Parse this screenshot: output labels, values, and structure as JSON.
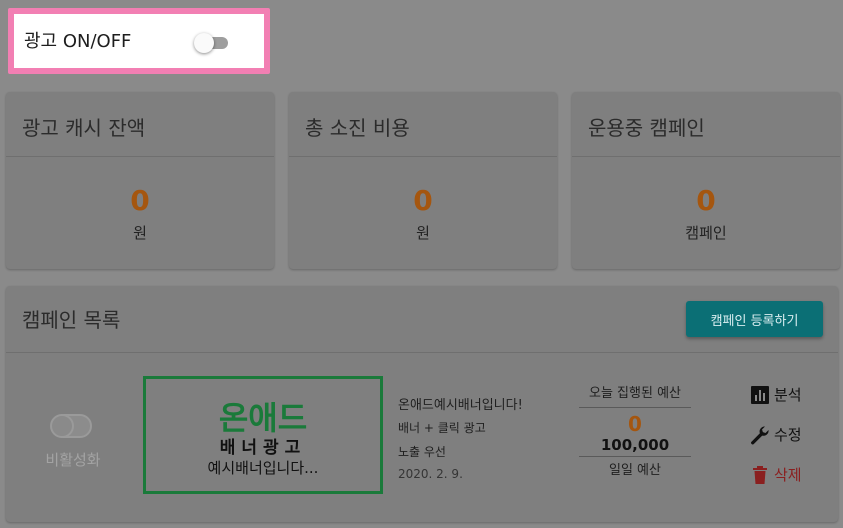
{
  "ad_toggle": {
    "label": "광고 ON/OFF"
  },
  "stats": [
    {
      "title": "광고 캐시 잔액",
      "value": "0",
      "unit": "원"
    },
    {
      "title": "총 소진 비용",
      "value": "0",
      "unit": "원"
    },
    {
      "title": "운용중 캠페인",
      "value": "0",
      "unit": "캠페인"
    }
  ],
  "campaign_list": {
    "title": "캠페인 목록",
    "register_button": "캠페인 등록하기",
    "rows": [
      {
        "status": "비활성화",
        "banner": {
          "line1": "온애드",
          "line2": "배너광고",
          "line3": "예시배너입니다..."
        },
        "name": "온애드예시배너입니다!",
        "type": "배너 + 클릭 광고",
        "exposure": "노출 우선",
        "date": "2020. 2. 9.",
        "budget": {
          "today_label": "오늘 집행된 예산",
          "today_value": "0",
          "daily_value": "100,000",
          "daily_label": "일일 예산"
        },
        "actions": {
          "analyze": "분석",
          "edit": "수정",
          "delete": "삭제"
        }
      }
    ]
  },
  "colors": {
    "highlight_border": "#f27fb3",
    "stat_value": "#a5560f",
    "primary_button": "#0b6f75",
    "banner_green": "#1a7a3a",
    "delete_red": "#8a1f1f"
  },
  "icons": {
    "analyze": "bar-chart-icon",
    "edit": "wrench-icon",
    "delete": "trash-icon"
  }
}
